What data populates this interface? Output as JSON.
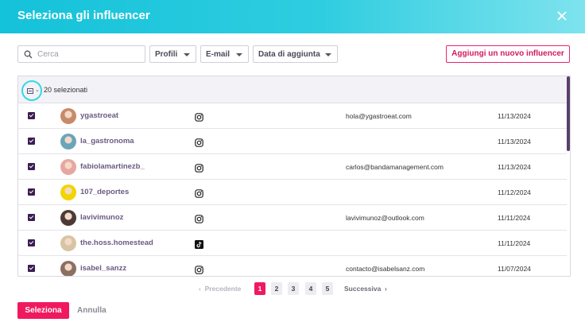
{
  "modal": {
    "title": "Seleziona gli influencer",
    "close_icon": "close-icon"
  },
  "toolbar": {
    "search": {
      "placeholder": "Cerca",
      "value": ""
    },
    "filters": [
      "Profili",
      "E-mail",
      "Data di aggiunta"
    ],
    "add_button": "Aggiungi un nuovo influencer"
  },
  "table": {
    "selected_label": "20 selezionati",
    "rows": [
      {
        "checked": true,
        "username": "ygastroeat",
        "platform": "instagram",
        "email": "hola@ygastroeat.com",
        "date": "11/13/2024",
        "avatar_color": "#c98a6a"
      },
      {
        "checked": true,
        "username": "la_gastronoma",
        "platform": "instagram",
        "email": "",
        "date": "11/13/2024",
        "avatar_color": "#6aa5b8"
      },
      {
        "checked": true,
        "username": "fabiolamartinezb_",
        "platform": "instagram",
        "email": "carlos@bandamanagement.com",
        "date": "11/13/2024",
        "avatar_color": "#e7a7a0"
      },
      {
        "checked": true,
        "username": "107_deportes",
        "platform": "instagram",
        "email": "",
        "date": "11/12/2024",
        "avatar_color": "#f2d400"
      },
      {
        "checked": true,
        "username": "lavivimunoz",
        "platform": "instagram",
        "email": "lavivimunoz@outlook.com",
        "date": "11/11/2024",
        "avatar_color": "#4d3a36"
      },
      {
        "checked": true,
        "username": "the.hoss.homestead",
        "platform": "tiktok",
        "email": "",
        "date": "11/11/2024",
        "avatar_color": "#d8c3a5"
      },
      {
        "checked": true,
        "username": "isabel_sanzz",
        "platform": "instagram",
        "email": "contacto@isabelsanz.com",
        "date": "11/07/2024",
        "avatar_color": "#8d6e63"
      }
    ]
  },
  "pagination": {
    "prev": "Precedente",
    "next": "Successiva",
    "pages": [
      "1",
      "2",
      "3",
      "4",
      "5"
    ],
    "current": "1"
  },
  "footer": {
    "select_button": "Seleziona",
    "cancel_button": "Annulla"
  },
  "colors": {
    "header_start": "#14c2d9",
    "accent": "#f0195f",
    "checkbox": "#3b1d52"
  }
}
